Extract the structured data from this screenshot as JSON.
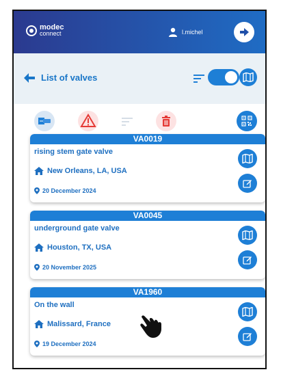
{
  "header": {
    "logo_main": "modec",
    "logo_sub": "connect",
    "username": "l.michel"
  },
  "subheader": {
    "title": "List of valves"
  },
  "valves": [
    {
      "id": "VA0019",
      "description": "rising stem gate valve",
      "location": "New Orleans, LA, USA",
      "date": "20 December 2024"
    },
    {
      "id": "VA0045",
      "description": "underground gate valve",
      "location": "Houston, TX, USA",
      "date": "20 November 2025"
    },
    {
      "id": "VA1960",
      "description": "On the wall",
      "location": "Malissard, France",
      "date": "19 December 2024"
    }
  ],
  "colors": {
    "brand_dark": "#2b3a8f",
    "brand_light": "#1e7fd6",
    "subheader_bg": "#eaf1f6",
    "danger_red": "#e53935",
    "text_blue": "#1e6fc0"
  },
  "icons": [
    "user-icon",
    "logout-icon",
    "back-arrow-icon",
    "sort-icon",
    "toggle",
    "map-icon",
    "export-icon",
    "warning-icon",
    "delete-icon",
    "qr-code-icon",
    "home-icon",
    "location-pin-icon",
    "edit-icon",
    "hand-pointer-icon"
  ]
}
